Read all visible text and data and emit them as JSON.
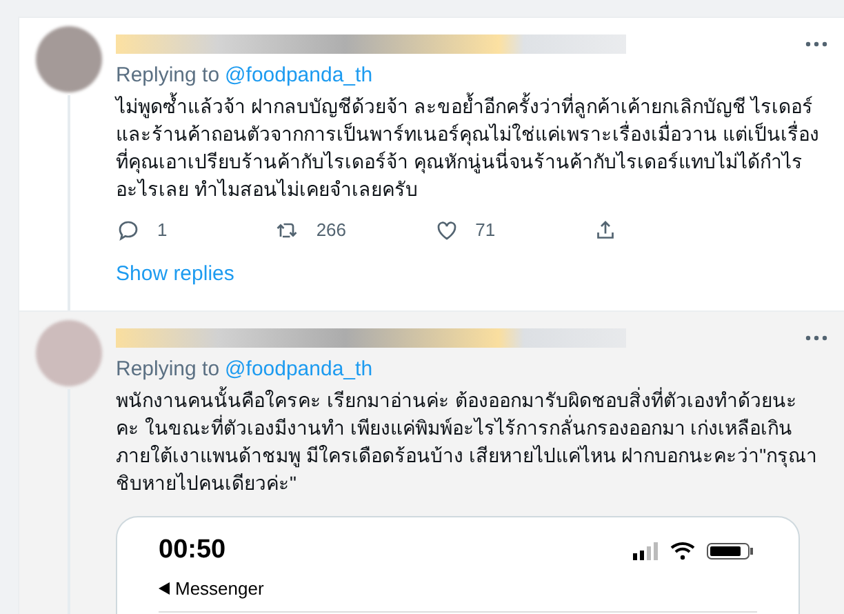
{
  "tweets": [
    {
      "replying_label": "Replying to",
      "replying_handle": "@foodpanda_th",
      "text": "ไม่พูดซ้ำแล้วจ้า ฝากลบบัญชีด้วยจ้า ละขอย้ำอีกครั้งว่าที่ลูกค้าเค้ายกเลิกบัญชี ไรเดอร์และร้านค้าถอนตัวจากการเป็นพาร์ทเนอร์คุณไม่ใช่แค่เพราะเรื่องเมื่อวาน แต่เป็นเรื่องที่คุณเอาเปรียบร้านค้ากับไรเดอร์จ้า คุณหักนู่นนี่จนร้านค้ากับไรเดอร์แทบไม่ได้กำไรอะไรเลย ทำไมสอนไม่เคยจำเลยครับ",
      "hovered": false,
      "actions": [
        {
          "kind": "reply",
          "count": "1"
        },
        {
          "kind": "retweet",
          "count": "266"
        },
        {
          "kind": "like",
          "count": "71"
        },
        {
          "kind": "share"
        }
      ],
      "show_replies": "Show replies"
    },
    {
      "replying_label": "Replying to",
      "replying_handle": "@foodpanda_th",
      "text": "พนักงานคนนั้นคือใครคะ เรียกมาอ่านค่ะ ต้องออกมารับผิดชอบสิ่งที่ตัวเองทำด้วยนะคะ ในขณะที่ตัวเองมีงานทำ เพียงแค่พิมพ์อะไรไร้การกลั่นกรองออกมา เก่งเหลือเกินภายใต้เงาแพนด้าชมพู มีใครเดือดร้อนบ้าง เสียหายไปแค่ไหน ฝากบอกนะคะว่า\"กรุณาชิบหายไปคนเดียวค่ะ\"",
      "hovered": true,
      "embed": {
        "time": "00:50",
        "back_app": "Messenger"
      }
    }
  ]
}
